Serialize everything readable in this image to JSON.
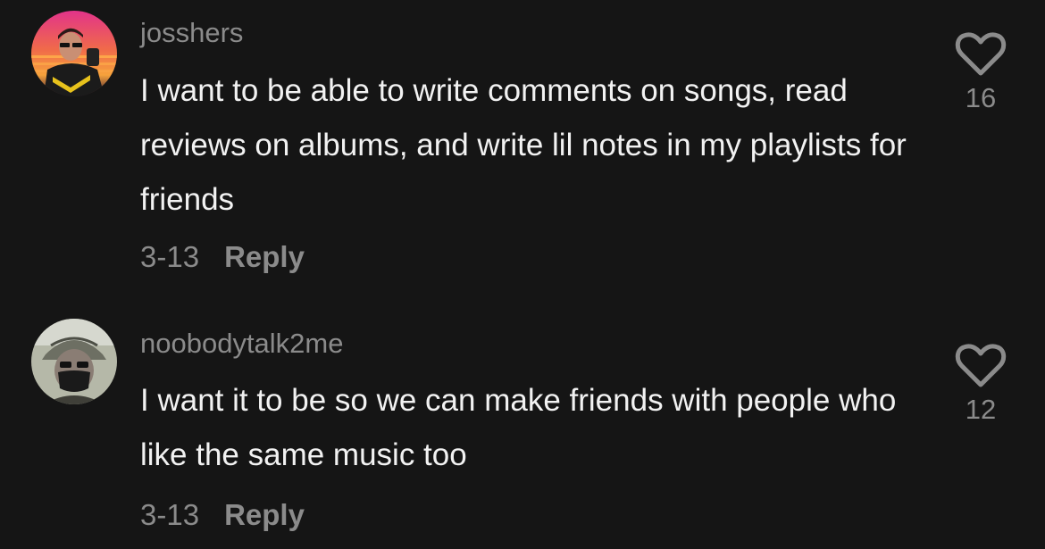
{
  "comments": [
    {
      "username": "josshers",
      "avatar_icon": "user-avatar-sunglasses-selfie",
      "text": "I want to be able to write comments on songs, read reviews on albums, and write lil notes in my playlists for friends",
      "date": "3-13",
      "reply_label": "Reply",
      "like_count": "16",
      "like_icon": "heart-outline-icon"
    },
    {
      "username": "noobodytalk2me",
      "avatar_icon": "user-avatar-bucket-hat-mask",
      "text": "I want it to be so we can make friends with people who like the same music too",
      "date": "3-13",
      "reply_label": "Reply",
      "like_count": "12",
      "like_icon": "heart-outline-icon"
    }
  ],
  "colors": {
    "background": "#151515",
    "text_primary": "#f2f2f2",
    "text_secondary": "#8b8b8b"
  }
}
